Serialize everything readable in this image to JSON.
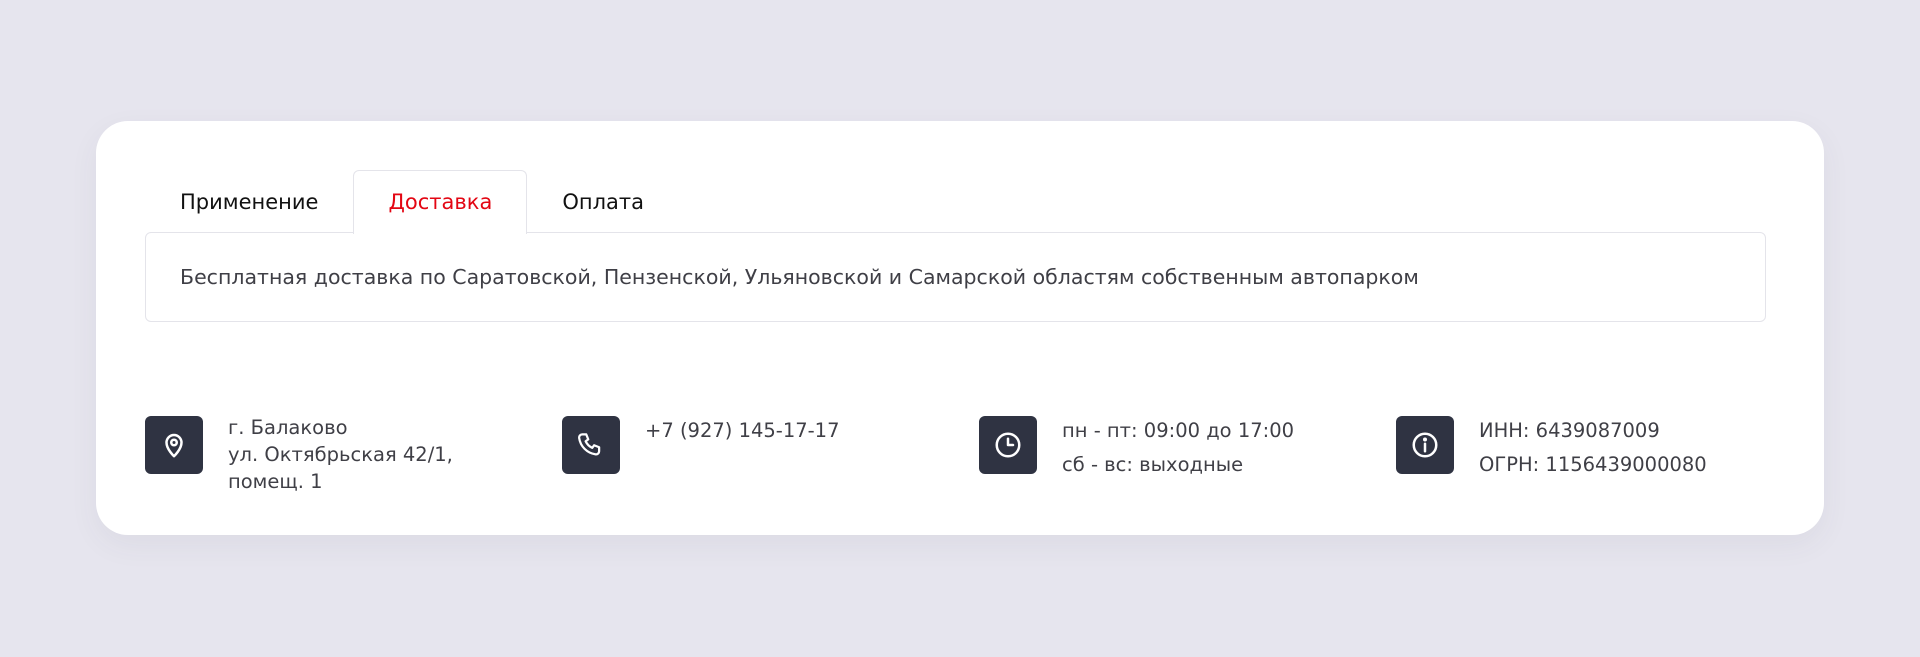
{
  "tabs": [
    {
      "label": "Применение",
      "active": false
    },
    {
      "label": "Доставка",
      "active": true
    },
    {
      "label": "Оплата",
      "active": false
    }
  ],
  "tab_panel": {
    "text": "Бесплатная доставка по Саратовской, Пензенской, Ульяновской и Самарской областям собственным автопарком"
  },
  "contacts": {
    "address": {
      "icon": "location-pin-icon",
      "lines": [
        "г. Балаково",
        "ул. Октябрьская 42/1,",
        "помещ. 1"
      ]
    },
    "phone": {
      "icon": "phone-icon",
      "lines": [
        "+7 (927) 145-17-17"
      ]
    },
    "hours": {
      "icon": "clock-icon",
      "lines": [
        "пн - пт: 09:00 до 17:00",
        "сб - вс: выходные"
      ]
    },
    "requisites": {
      "icon": "info-icon",
      "lines": [
        "ИНН: 6439087009",
        "ОГРН: 1156439000080"
      ]
    }
  },
  "colors": {
    "background": "#e6e5ee",
    "card": "#ffffff",
    "accent": "#e30613",
    "icon_box": "#2f3342",
    "text": "#3f3f46",
    "border": "#e4e4ea"
  }
}
